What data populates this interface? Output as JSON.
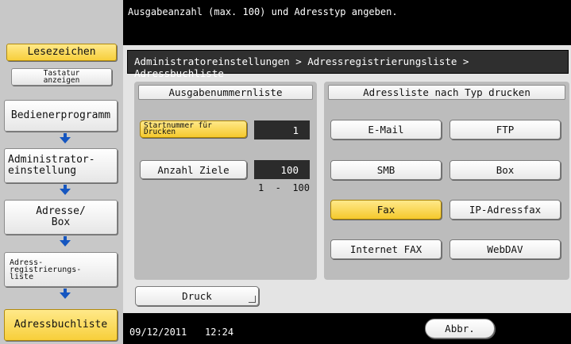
{
  "header": {
    "instruction": "Ausgabeanzahl (max. 100) und Adresstyp angeben."
  },
  "sidebar": {
    "bookmark_label": "Lesezeichen",
    "keyboard_label": "Tastatur anzeigen",
    "items": [
      {
        "label": "Bedienerprogramm"
      },
      {
        "label": "Administrator-\neinstellung"
      },
      {
        "label": "Adresse/\nBox"
      },
      {
        "label": "Adress-\nregistrierungs-\nliste"
      },
      {
        "label": "Adressbuchliste"
      }
    ]
  },
  "breadcrumb": "Administratoreinstellungen > Adressregistrierungsliste > Adressbuchliste",
  "output_panel": {
    "title": "Ausgabenummernliste",
    "start_label": "Startnummer für Drucken",
    "start_value": "1",
    "count_label": "Anzahl Ziele",
    "count_value": "100",
    "range": "1  -  100"
  },
  "type_panel": {
    "title": "Adressliste nach Typ drucken",
    "buttons": [
      {
        "label": "E-Mail",
        "selected": false
      },
      {
        "label": "FTP",
        "selected": false
      },
      {
        "label": "SMB",
        "selected": false
      },
      {
        "label": "Box",
        "selected": false
      },
      {
        "label": "Fax",
        "selected": true
      },
      {
        "label": "IP-Adressfax",
        "selected": false
      },
      {
        "label": "Internet FAX",
        "selected": false
      },
      {
        "label": "WebDAV",
        "selected": false
      }
    ]
  },
  "print_button": "Druck",
  "status": {
    "date": "09/12/2011",
    "time": "12:24",
    "cancel_label": "Abbr."
  },
  "colors": {
    "highlight": "#f7cf3b",
    "arrow": "#1556c0"
  }
}
